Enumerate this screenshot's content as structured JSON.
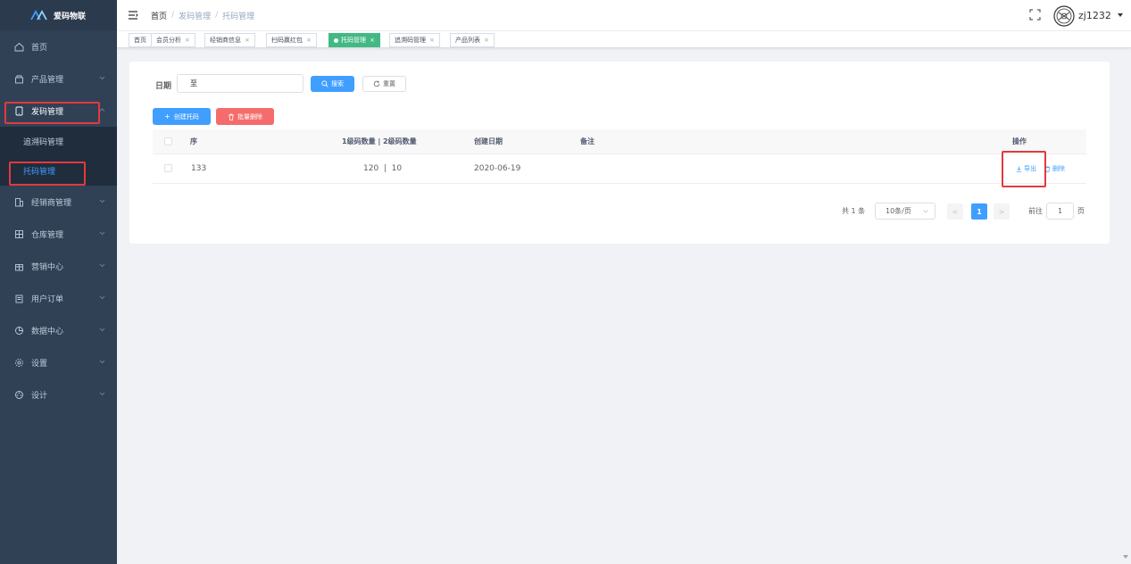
{
  "brand": {
    "name": "爱码物联"
  },
  "sidebar": {
    "items": [
      {
        "label": "首页",
        "icon": "home-icon"
      },
      {
        "label": "产品管理",
        "icon": "gift-icon"
      },
      {
        "label": "发码管理",
        "icon": "tablet-icon"
      },
      {
        "label": "经销商管理",
        "icon": "building-icon"
      },
      {
        "label": "仓库管理",
        "icon": "grid-icon"
      },
      {
        "label": "营销中心",
        "icon": "gift-box-icon"
      },
      {
        "label": "用户订单",
        "icon": "clipboard-icon"
      },
      {
        "label": "数据中心",
        "icon": "pie-chart-icon"
      },
      {
        "label": "设置",
        "icon": "gear-icon"
      },
      {
        "label": "设计",
        "icon": "palette-icon"
      }
    ],
    "submenu": [
      {
        "label": "追溯码管理"
      },
      {
        "label": "托码管理"
      }
    ]
  },
  "navbar": {
    "breadcrumb": [
      "首页",
      "发码管理",
      "托码管理"
    ],
    "separator": "/",
    "username": "zj1232"
  },
  "tags": [
    {
      "label": "首页",
      "closable": false
    },
    {
      "label": "会员分析",
      "close": "×"
    },
    {
      "label": "经销商信息",
      "close": "×"
    },
    {
      "label": "扫码赢红包",
      "close": "×"
    },
    {
      "label": "托码管理",
      "close": "×"
    },
    {
      "label": "追溯码管理",
      "close": "×"
    },
    {
      "label": "产品列表",
      "close": "×"
    }
  ],
  "filter": {
    "date_label": "日期",
    "range_separator": "至",
    "search_label": "搜索",
    "reset_label": "重置"
  },
  "actions": {
    "create_label": "创建托码",
    "batch_delete_label": "批量删除"
  },
  "table": {
    "headers": {
      "seq": "序",
      "counts": "1级码数量 | 2级码数量",
      "created": "创建日期",
      "remark": "备注",
      "ops": "操作"
    },
    "rows": [
      {
        "seq": "133",
        "counts": "120  |  10",
        "created": "2020-06-19",
        "remark": "",
        "export_label": "导出",
        "delete_label": "删除"
      }
    ]
  },
  "pagination": {
    "total": "共 1 条",
    "page_size": "10条/页",
    "prev": "<",
    "current": "1",
    "next": ">",
    "goto_label": "前往",
    "goto_value": "1",
    "page_suffix": "页"
  },
  "colors": {
    "primary": "#409eff",
    "danger": "#f56c6c",
    "active_tag": "#42b983",
    "sidebar_bg": "#304156",
    "highlight_box": "#e4393c"
  }
}
